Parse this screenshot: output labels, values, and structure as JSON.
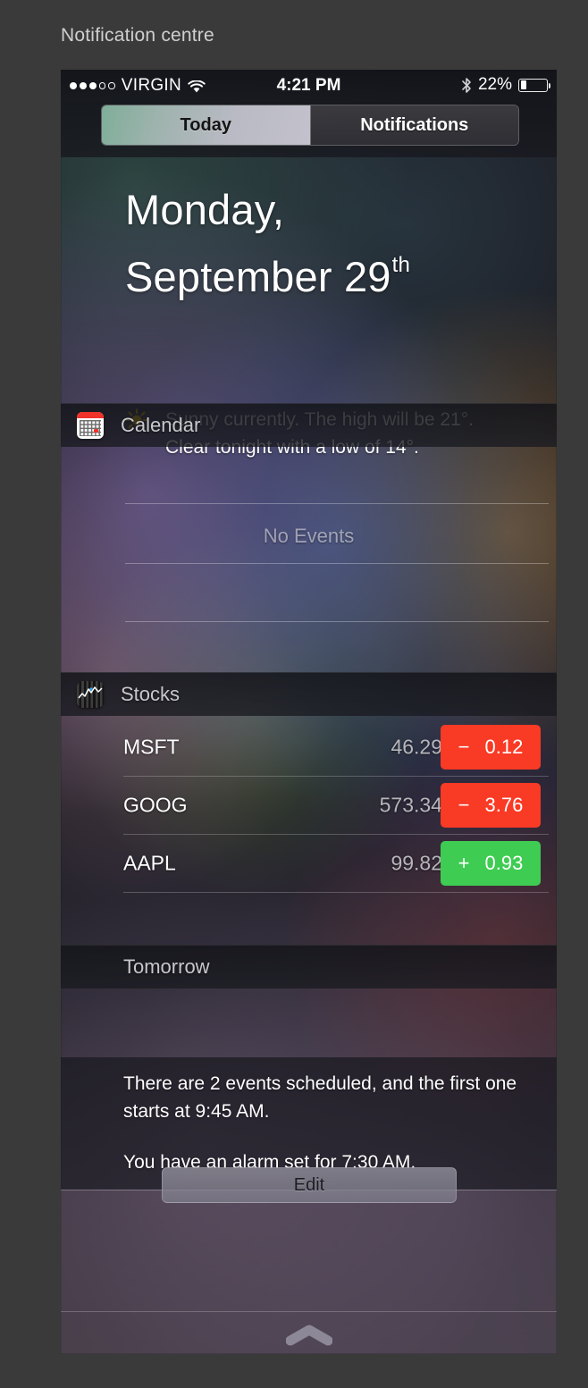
{
  "page": {
    "caption": "Notification centre"
  },
  "status_bar": {
    "signal_dots_filled": 3,
    "signal_dots_total": 5,
    "carrier": "VIRGIN",
    "wifi_icon": "wifi-icon",
    "time": "4:21 PM",
    "bluetooth_icon": "bluetooth-icon",
    "battery_percent": "22%",
    "battery_level": 22
  },
  "segmented_control": {
    "today_label": "Today",
    "notifications_label": "Notifications",
    "selected": "Today"
  },
  "today": {
    "weekday": "Monday,",
    "month_day": "September 29",
    "ordinal_suffix": "th",
    "weather_icon": "sun-icon",
    "weather_text": "Sunny currently. The high will be 21°. Clear tonight with a low of 14°."
  },
  "calendar_widget": {
    "icon": "calendar-icon",
    "title": "Calendar",
    "empty_text": "No Events"
  },
  "stocks_widget": {
    "icon": "stocks-icon",
    "title": "Stocks",
    "rows": [
      {
        "symbol": "MSFT",
        "price": "46.29",
        "sign": "−",
        "change": "0.12",
        "direction": "down"
      },
      {
        "symbol": "GOOG",
        "price": "573.34",
        "sign": "−",
        "change": "3.76",
        "direction": "down"
      },
      {
        "symbol": "AAPL",
        "price": "99.82",
        "sign": "+",
        "change": "0.93",
        "direction": "up"
      }
    ]
  },
  "tomorrow": {
    "title": "Tomorrow",
    "events_text": "There are 2 events scheduled, and the first one starts at 9:45 AM.",
    "alarm_text": "You have an alarm set for 7:30 AM."
  },
  "footer": {
    "edit_label": "Edit",
    "grabber_icon": "chevron-up-grabber-icon"
  },
  "colors": {
    "down_badge": "#f93a25",
    "up_badge": "#3ecc52",
    "page_background": "#3a3a3a",
    "accent_today_tab": "#7fae99"
  }
}
